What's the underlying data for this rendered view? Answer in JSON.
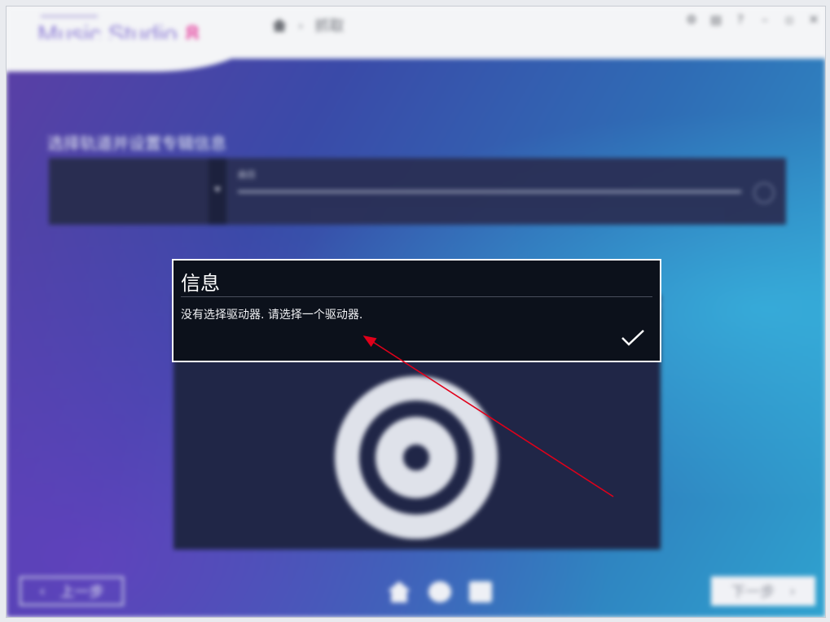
{
  "app": {
    "logo_text": "Music Studio",
    "logo_version": "8",
    "breadcrumb": {
      "current": "抓取"
    },
    "window_controls": [
      "settings-icon",
      "notes-icon",
      "help-icon",
      "minimize-icon",
      "restore-icon",
      "close-icon"
    ]
  },
  "main": {
    "section_title": "选择轨道并设置专辑信息",
    "track_label": "曲目"
  },
  "footer": {
    "prev_label": "上一步",
    "next_label": "下一步"
  },
  "dialog": {
    "title": "信息",
    "message": "没有选择驱动器. 请选择一个驱动器.",
    "confirm_icon": "checkmark-icon"
  },
  "annotation": {
    "color": "#e0001a"
  },
  "colors": {
    "dialog_bg": "#0c111b",
    "dialog_border": "#ffffff",
    "accent_purple": "#8f7fd6",
    "accent_pink": "#e64fa5"
  }
}
